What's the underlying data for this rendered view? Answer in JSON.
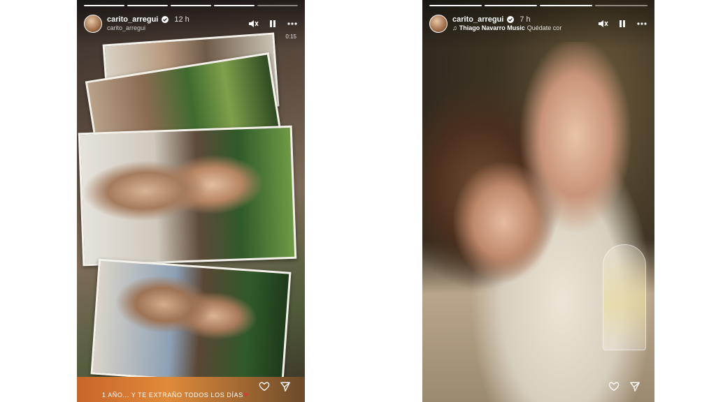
{
  "stories": [
    {
      "username": "carito_arregui",
      "time": "12 h",
      "subline": "carito_arregui",
      "duration": "0:15",
      "caption": "1 AÑO... Y TE EXTRAÑO TODOS LOS DÍAS",
      "caption_heart": "❤",
      "progress": [
        true,
        true,
        true,
        true,
        false
      ]
    },
    {
      "username": "carito_arregui",
      "time": "7 h",
      "music_artist": "Thiago Navarro Music",
      "music_desc": "Quédate cor",
      "progress": [
        true,
        true,
        true,
        false
      ]
    }
  ],
  "icons": {
    "mute": "mute-icon",
    "pause": "pause-icon",
    "more": "more-options-icon",
    "like": "heart-icon",
    "send": "send-icon",
    "verified": "verified-badge-icon"
  },
  "colors": {
    "accent_red": "#d63b3b"
  }
}
